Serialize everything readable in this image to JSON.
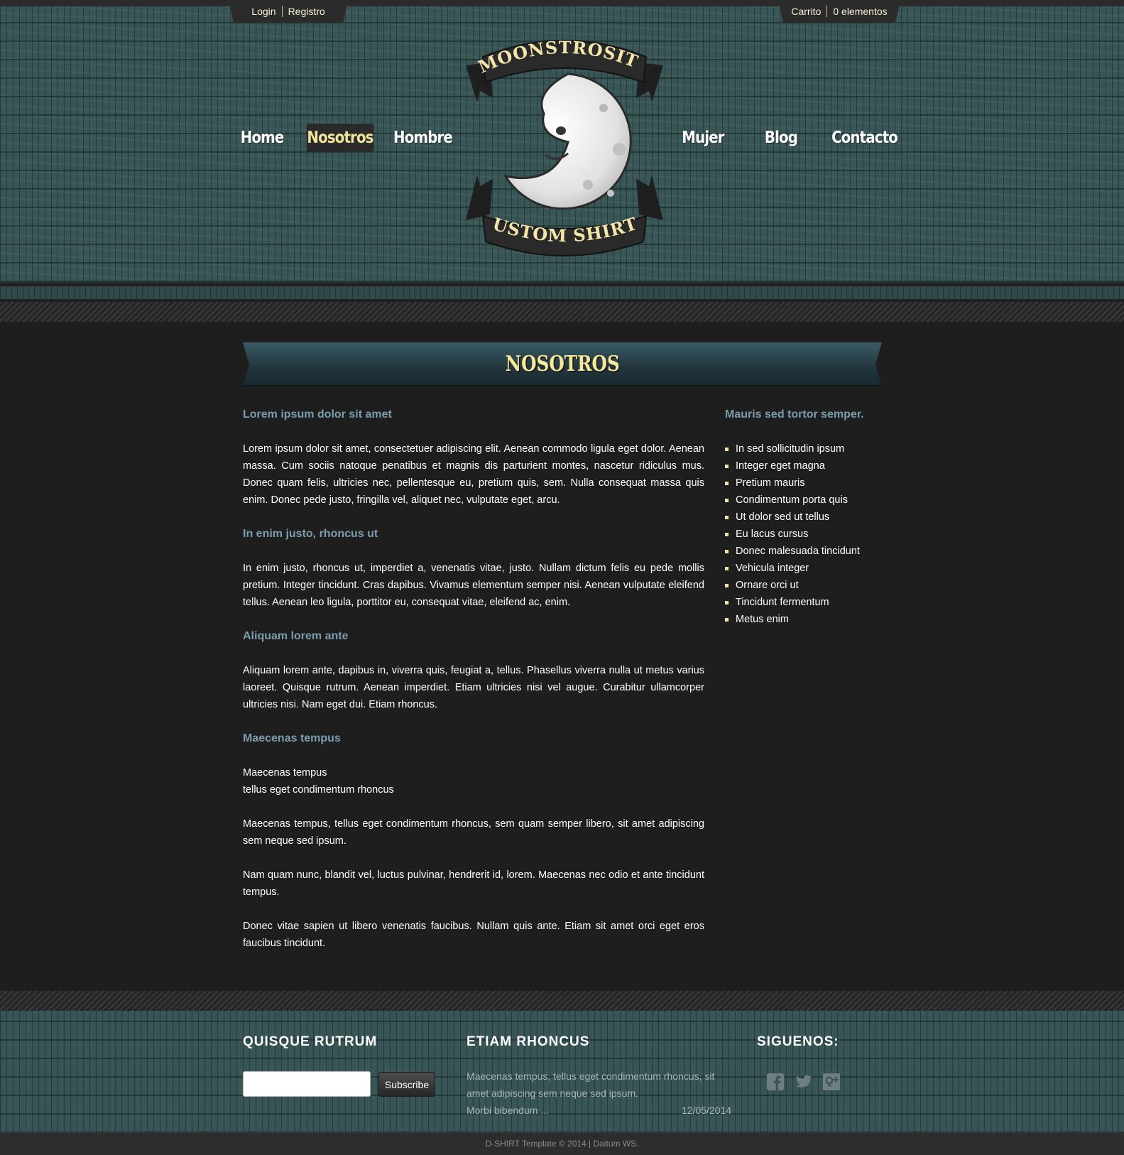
{
  "topbar": {
    "login": "Login",
    "register": "Registro",
    "cart": "Carrito",
    "cart_items": "0 elementos"
  },
  "nav": {
    "items": [
      "Home",
      "Nosotros",
      "Hombre",
      "Mujer",
      "Blog",
      "Contacto"
    ],
    "active": "Nosotros"
  },
  "logo": {
    "top_text": "MOONSTROSITY",
    "bottom_text": "CUSTOM SHIRTS"
  },
  "page": {
    "title": "NOSOTROS"
  },
  "main": {
    "sections": [
      {
        "heading": "Lorem ipsum dolor sit amet",
        "paragraphs": [
          "Lorem ipsum dolor sit amet, consectetuer adipiscing elit. Aenean commodo ligula eget dolor. Aenean massa. Cum sociis natoque penatibus et magnis dis parturient montes, nascetur ridiculus mus. Donec quam felis, ultricies nec, pellentesque eu, pretium quis, sem. Nulla consequat massa quis enim. Donec pede justo, fringilla vel, aliquet nec, vulputate eget, arcu."
        ]
      },
      {
        "heading": "In enim justo, rhoncus ut",
        "paragraphs": [
          "In enim justo, rhoncus ut, imperdiet a, venenatis vitae, justo. Nullam dictum felis eu pede mollis pretium. Integer tincidunt. Cras dapibus. Vivamus elementum semper nisi. Aenean vulputate eleifend tellus. Aenean leo ligula, porttitor eu, consequat vitae, eleifend ac, enim."
        ]
      },
      {
        "heading": "Aliquam lorem ante",
        "paragraphs": [
          "Aliquam lorem ante, dapibus in, viverra quis, feugiat a, tellus. Phasellus viverra nulla ut metus varius laoreet. Quisque rutrum. Aenean imperdiet. Etiam ultricies nisi vel augue. Curabitur ullamcorper ultricies nisi. Nam eget dui. Etiam rhoncus."
        ]
      },
      {
        "heading": "Maecenas tempus",
        "paragraphs": [
          "Maecenas tempus\ntellus eget condimentum rhoncus",
          "Maecenas tempus, tellus eget condimentum rhoncus, sem quam semper libero, sit amet adipiscing sem neque sed ipsum.",
          "Nam quam nunc, blandit vel, luctus pulvinar, hendrerit id, lorem. Maecenas nec odio et ante tincidunt tempus.",
          "Donec vitae sapien ut libero venenatis faucibus. Nullam quis ante. Etiam sit amet orci eget eros faucibus tincidunt."
        ]
      }
    ]
  },
  "sidebar": {
    "heading": "Mauris sed tortor semper.",
    "items": [
      "In sed sollicitudin ipsum",
      "Integer eget magna",
      "Pretium mauris",
      "Condimentum porta quis",
      "Ut dolor sed ut tellus",
      "Eu lacus cursus",
      "Donec malesuada tincidunt",
      "Vehicula integer",
      "Ornare orci ut",
      "Tincidunt fermentum",
      "Metus enim"
    ]
  },
  "footer": {
    "col1_title": "QUISQUE RUTRUM",
    "subscribe_value": "",
    "subscribe_label": "Subscribe",
    "col2_title": "ETIAM RHONCUS",
    "post_text": "Maecenas tempus, tellus eget condimentum rhoncus, sit amet adipiscing sem neque sed ipsum.",
    "post_more": "Morbi bibendum ...",
    "post_date": "12/05/2014",
    "col3_title": "SIGUENOS:",
    "social": [
      "facebook-icon",
      "twitter-icon",
      "google-plus-icon"
    ],
    "copyright": "D-SHIRT Template © 2014 | Daitum WS."
  },
  "colors": {
    "accent_yellow": "#f2e39a",
    "heading_blue": "#7b9cac",
    "header_teal": "#3a5556",
    "body_bg": "#1e1e1e"
  }
}
